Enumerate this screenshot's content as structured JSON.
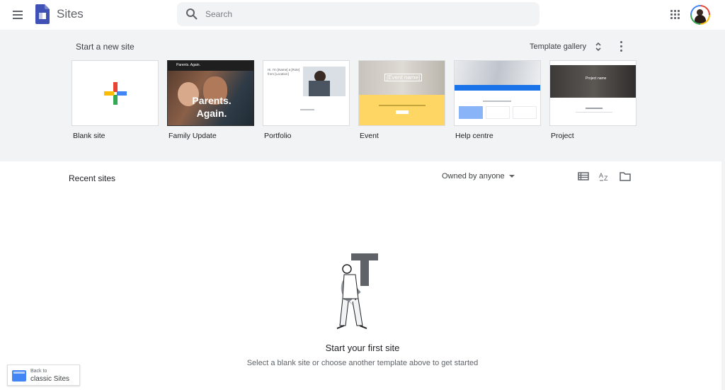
{
  "app": {
    "title": "Sites"
  },
  "search": {
    "placeholder": "Search"
  },
  "templates": {
    "heading": "Start a new site",
    "gallery_label": "Template gallery",
    "items": [
      {
        "label": "Blank site"
      },
      {
        "label": "Family Update",
        "thumb_title": "Parents. Again.",
        "thumb_header": "Parents. Again."
      },
      {
        "label": "Portfolio",
        "thumb_text": "Hi. I'm [Name] a [Role] from [Location]"
      },
      {
        "label": "Event",
        "thumb_text": "[Event name]"
      },
      {
        "label": "Help centre"
      },
      {
        "label": "Project",
        "thumb_text": "Project name"
      }
    ]
  },
  "recent": {
    "heading": "Recent sites",
    "owner_filter": "Owned by anyone",
    "empty_title": "Start your first site",
    "empty_subtitle": "Select a blank site or choose another template above to get started"
  },
  "classic": {
    "line1": "Back to",
    "line2": "classic Sites"
  },
  "icons": [
    "menu-icon",
    "sites-logo-icon",
    "search-icon",
    "apps-grid-icon",
    "more-vert-icon",
    "list-view-icon",
    "sort-az-icon",
    "folder-icon",
    "unfold-icon",
    "plus-icon"
  ],
  "colors": {
    "brand_blue": "#4285f4",
    "red": "#ea4335",
    "yellow": "#fbbc04",
    "green": "#34a853",
    "strip_bg": "#f1f3f4"
  }
}
